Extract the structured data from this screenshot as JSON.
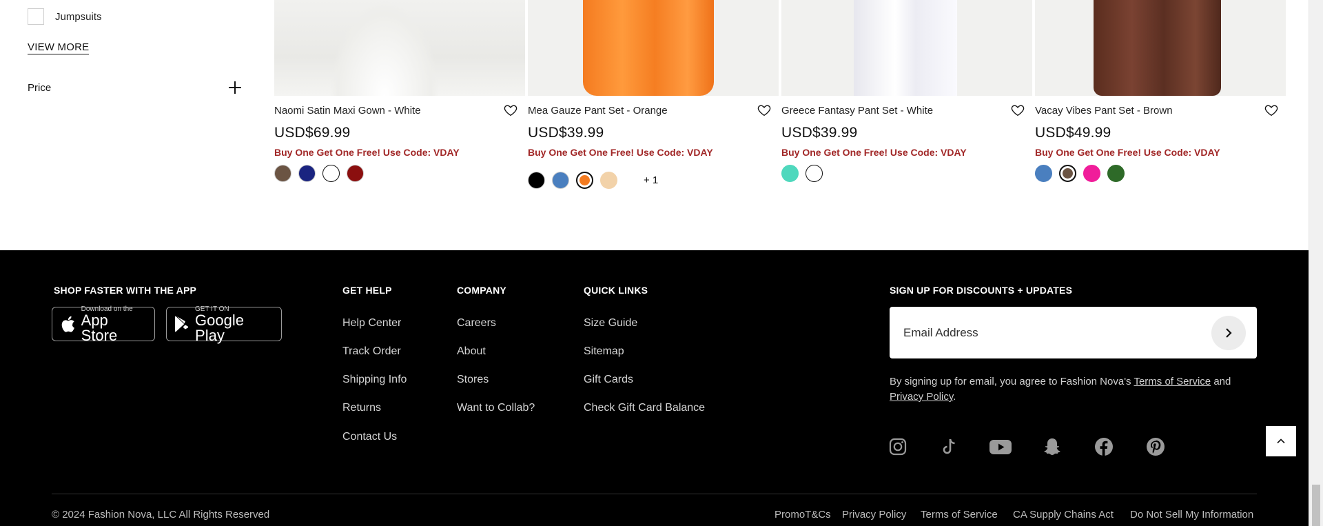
{
  "sidebar": {
    "jumpsuits_label": "Jumpsuits",
    "view_more": "VIEW MORE",
    "price_label": "Price"
  },
  "products": [
    {
      "title": "Naomi Satin Maxi Gown - White",
      "price": "USD$69.99",
      "promo": "Buy One Get One Free! Use Code: VDAY",
      "swatches": [
        "#6b5443",
        "#1a2480",
        "#ffffff",
        "#8b0f0f"
      ]
    },
    {
      "title": "Mea Gauze Pant Set - Orange",
      "price": "USD$39.99",
      "promo": "Buy One Get One Free! Use Code: VDAY",
      "swatches": [
        "#000000",
        "#4a7fbf",
        "#f47b20",
        "#f2d2a9"
      ],
      "selected_swatch": "#f47b20",
      "more": "+ 1"
    },
    {
      "title": "Greece Fantasy Pant Set - White",
      "price": "USD$39.99",
      "promo": "Buy One Get One Free! Use Code: VDAY",
      "swatches": [
        "#4fd8bd",
        "#ffffff"
      ]
    },
    {
      "title": "Vacay Vibes Pant Set - Brown",
      "price": "USD$49.99",
      "promo": "Buy One Get One Free! Use Code: VDAY",
      "swatches": [
        "#4a7fbf",
        "#6b5443",
        "#f01d9a",
        "#2e6a28"
      ],
      "selected_swatch": "#6b5443"
    }
  ],
  "footer": {
    "app_heading": "SHOP FASTER WITH THE APP",
    "app_store_small": "Download on the",
    "app_store_big": "App Store",
    "google_small": "GET IT ON",
    "google_big": "Google Play",
    "help_heading": "GET HELP",
    "help_links": [
      "Help Center",
      "Track Order",
      "Shipping Info",
      "Returns",
      "Contact Us"
    ],
    "company_heading": "COMPANY",
    "company_links": [
      "Careers",
      "About",
      "Stores",
      "Want to Collab?"
    ],
    "quick_heading": "QUICK LINKS",
    "quick_links": [
      "Size Guide",
      "Sitemap",
      "Gift Cards",
      "Check Gift Card Balance"
    ],
    "signup_heading": "SIGN UP FOR DISCOUNTS + UPDATES",
    "email_placeholder": "Email Address",
    "legal_prefix": "By signing up for email, you agree to Fashion Nova's ",
    "terms_link": "Terms of Service",
    "legal_and": " and",
    "privacy_link": "Privacy Policy",
    "legal_suffix": ".",
    "social": [
      "instagram-icon",
      "tiktok-icon",
      "youtube-icon",
      "snapchat-icon",
      "facebook-icon",
      "pinterest-icon"
    ],
    "copyright": "© 2024 Fashion Nova, LLC All Rights Reserved",
    "bottom_links": [
      "PromoT&Cs",
      "Privacy Policy",
      "Terms of Service",
      "CA Supply Chains Act",
      "Do Not Sell My Information"
    ]
  },
  "colors": {
    "promo": "#a12727",
    "footer_bg": "#000000"
  }
}
